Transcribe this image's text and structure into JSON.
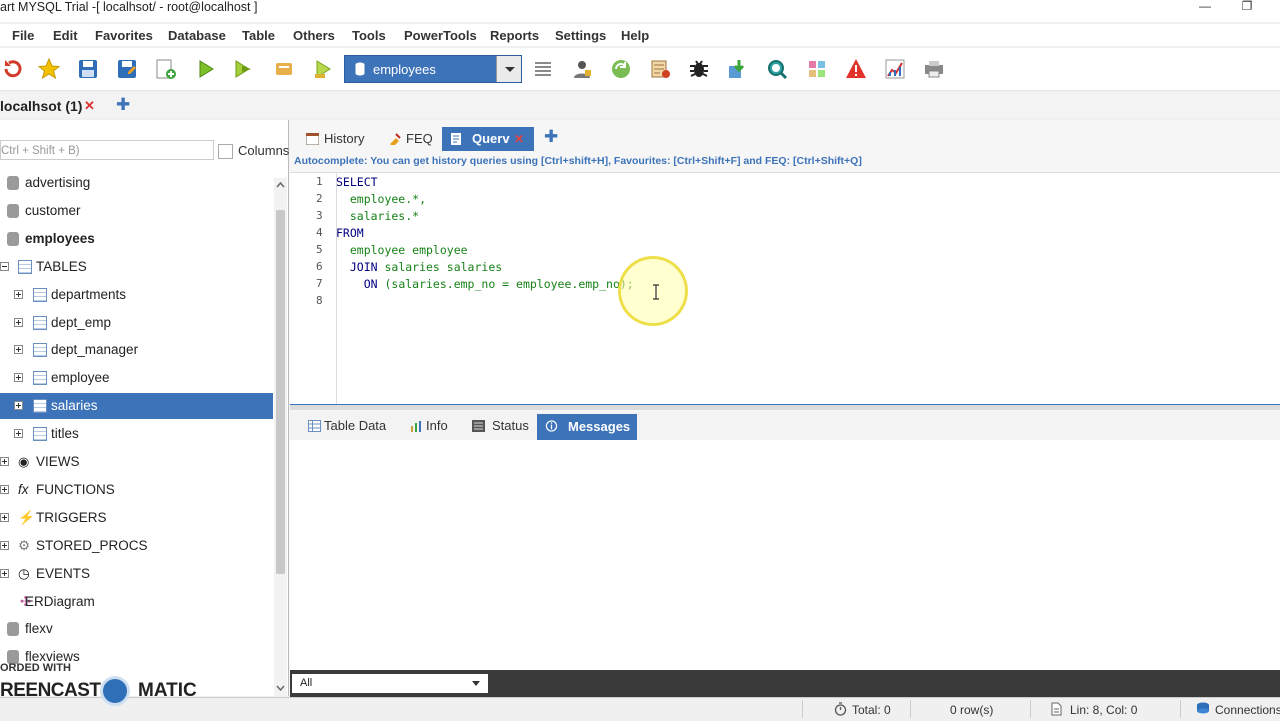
{
  "window": {
    "title": "art MYSQL Trial -[ localhsot/ - root@localhost ]",
    "minimize_glyph": "—",
    "restore_glyph": "❐"
  },
  "menu": [
    "File",
    "Edit",
    "Favorites",
    "Database",
    "Table",
    "Others",
    "Tools",
    "PowerTools",
    "Reports",
    "Settings",
    "Help"
  ],
  "toolbar": {
    "database_selected": "employees",
    "icons": [
      "refresh-icon",
      "favorite-star-icon",
      "save-icon",
      "save-as-icon",
      "add-query-icon",
      "execute-icon",
      "execute-all-icon",
      "edit-icon",
      "execute-selected-icon",
      "list-icon",
      "user-icon",
      "backup-icon",
      "scheduler-icon",
      "debug-icon",
      "import-icon",
      "search-icon",
      "tools-icon",
      "warning-icon",
      "chart-icon",
      "print-icon"
    ]
  },
  "connection_tab": {
    "label": "localhsot (1)",
    "close": "✕",
    "add": "✚"
  },
  "object_filter": {
    "placeholder": "Ctrl + Shift + B)",
    "columns_label": "Columns"
  },
  "tree": [
    {
      "label": "advertising",
      "level": 0,
      "icon": "database-icon",
      "bold": false
    },
    {
      "label": "customer",
      "level": 0,
      "icon": "database-icon",
      "bold": false
    },
    {
      "label": "employees",
      "level": 0,
      "icon": "database-icon",
      "bold": true
    },
    {
      "label": "TABLES",
      "level": 0,
      "icon": "tables-icon",
      "bold": false,
      "expander": "minus"
    },
    {
      "label": "departments",
      "level": 1,
      "icon": "table-icon",
      "expander": "plus"
    },
    {
      "label": "dept_emp",
      "level": 1,
      "icon": "table-icon",
      "expander": "plus"
    },
    {
      "label": "dept_manager",
      "level": 1,
      "icon": "table-icon",
      "expander": "plus"
    },
    {
      "label": "employee",
      "level": 1,
      "icon": "table-icon",
      "expander": "plus"
    },
    {
      "label": "salaries",
      "level": 1,
      "icon": "table-icon",
      "expander": "plus",
      "selected": true
    },
    {
      "label": "titles",
      "level": 1,
      "icon": "table-icon",
      "expander": "plus"
    },
    {
      "label": "VIEWS",
      "level": 0,
      "icon": "eye-icon",
      "expander": "plus"
    },
    {
      "label": "FUNCTIONS",
      "level": 0,
      "icon": "function-icon",
      "expander": "plus"
    },
    {
      "label": "TRIGGERS",
      "level": 0,
      "icon": "lightning-icon",
      "expander": "plus"
    },
    {
      "label": "STORED_PROCS",
      "level": 0,
      "icon": "gear-icon",
      "expander": "plus"
    },
    {
      "label": "EVENTS",
      "level": 0,
      "icon": "clock-icon",
      "expander": "plus"
    },
    {
      "label": "ERDiagram",
      "level": 0,
      "icon": "diagram-icon"
    },
    {
      "label": "flexv",
      "level": 0,
      "icon": "database-icon"
    },
    {
      "label": "flexviews",
      "level": 0,
      "icon": "database-icon"
    }
  ],
  "query_tabs": [
    {
      "label": "History",
      "active": false
    },
    {
      "label": "FEQ",
      "active": false
    },
    {
      "label": "Querv",
      "active": true,
      "close": "✕"
    }
  ],
  "query_add": "✚",
  "autocomplete_hint": "Autocomplete: You can get history queries using [Ctrl+shift+H], Favourites: [Ctrl+Shift+F] and FEQ: [Ctrl+Shift+Q]",
  "editor": {
    "line_numbers": [
      "1",
      "2",
      "3",
      "4",
      "5",
      "6",
      "7",
      "8"
    ],
    "lines": [
      [
        {
          "t": "SELECT",
          "c": "kw"
        }
      ],
      [
        {
          "t": "  employee.*,",
          "c": "id"
        }
      ],
      [
        {
          "t": "  salaries.*",
          "c": "id"
        }
      ],
      [
        {
          "t": "FROM",
          "c": "kw"
        }
      ],
      [
        {
          "t": "  employee employee",
          "c": "id"
        }
      ],
      [
        {
          "t": "  JOIN ",
          "c": "kw"
        },
        {
          "t": "salaries salaries",
          "c": "id"
        }
      ],
      [
        {
          "t": "    ON ",
          "c": "kw"
        },
        {
          "t": "(salaries.emp_no = employee.emp_no);",
          "c": "id"
        }
      ],
      []
    ]
  },
  "result_tabs": [
    {
      "label": "Table Data",
      "active": false
    },
    {
      "label": "Info",
      "active": false
    },
    {
      "label": "Status",
      "active": false
    },
    {
      "label": "Messages",
      "active": true
    }
  ],
  "result_filter": "All",
  "statusbar": {
    "total": "Total: 0",
    "rows": "0 row(s)",
    "position": "Lin: 8, Col: 0",
    "connections": "Connections"
  },
  "watermark": {
    "line1": "ORDED WITH",
    "line2": "REENCAST",
    "line3": "MATIC"
  },
  "colors": {
    "accent": "#3d73b9",
    "keyword": "#000080",
    "identifier": "#178217"
  }
}
